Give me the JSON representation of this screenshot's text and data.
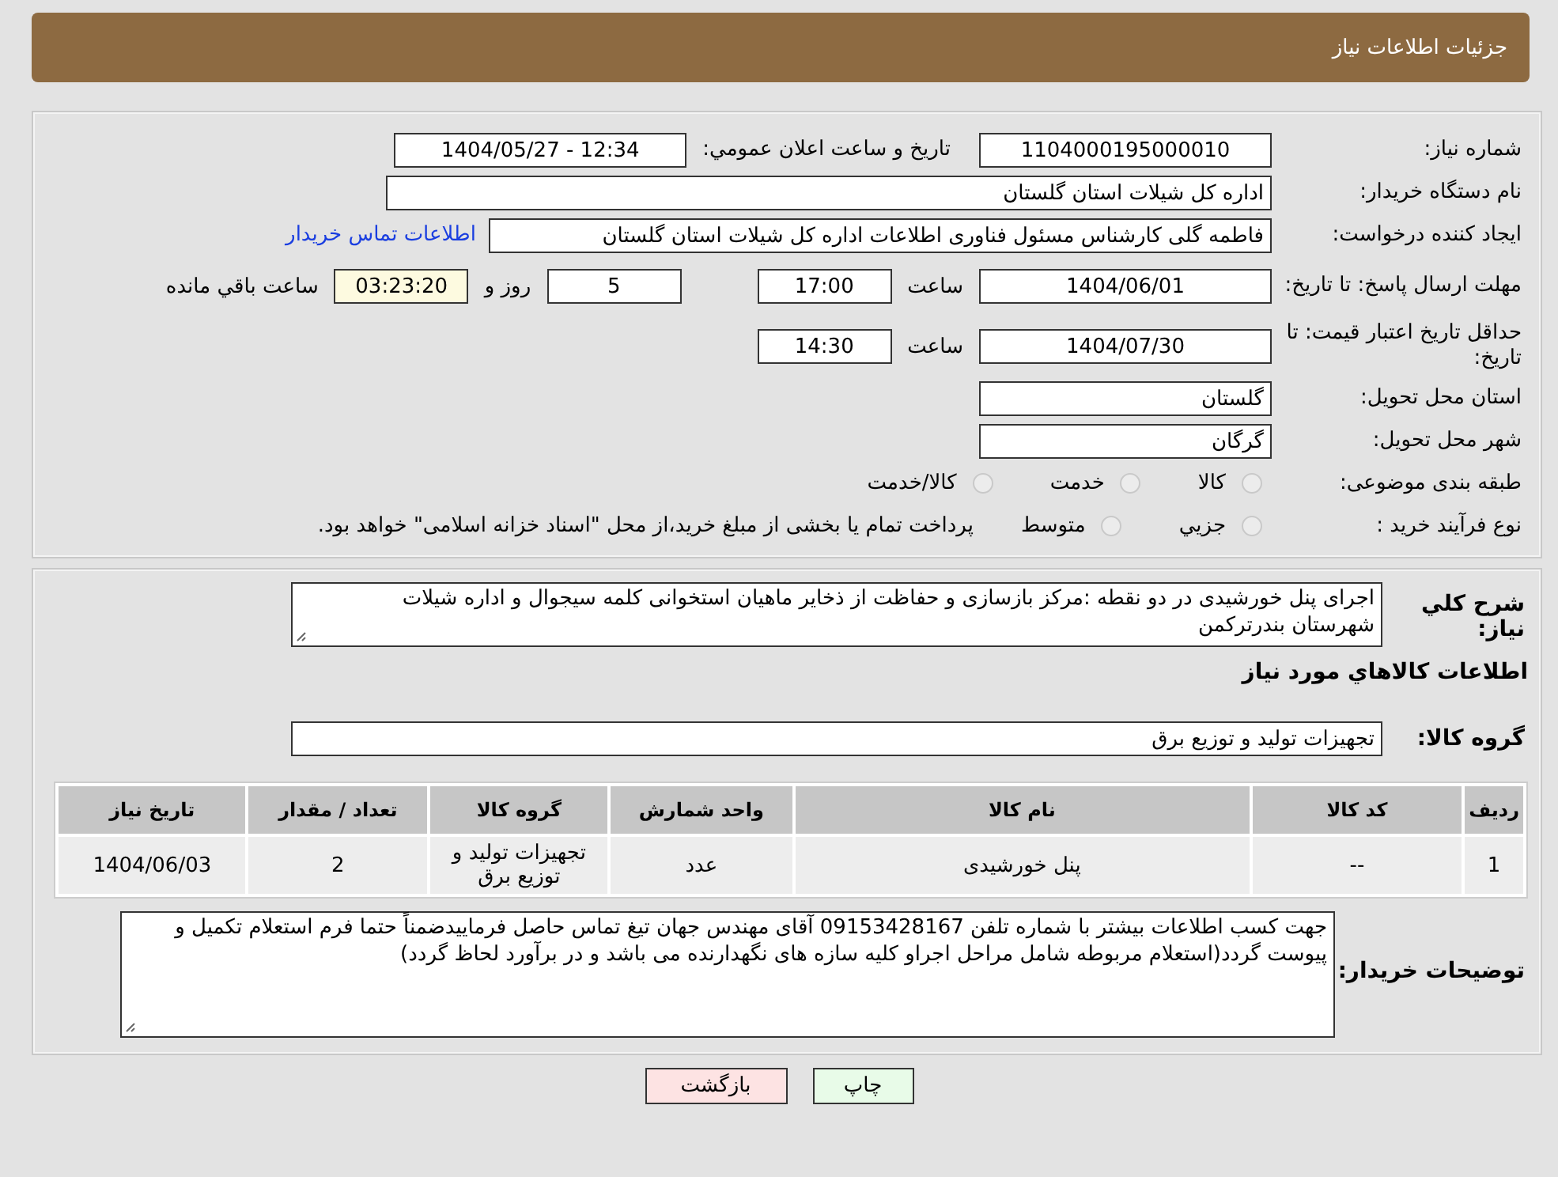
{
  "header": {
    "title": "جزئیات اطلاعات نیاز"
  },
  "need_number": {
    "label": "شماره نیاز:",
    "value": "1104000195000010"
  },
  "announce": {
    "label": "تاریخ و ساعت اعلان عمومي:",
    "value": "1404/05/27 - 12:34"
  },
  "buyer": {
    "label": "نام دستگاه خریدار:",
    "value": "اداره کل شیلات استان گلستان"
  },
  "creator": {
    "label": "ایجاد کننده درخواست:",
    "value": "فاطمه گلی کارشناس مسئول فناوری اطلاعات اداره کل شیلات استان گلستان",
    "link": "اطلاعات تماس خریدار"
  },
  "deadline": {
    "label": "مهلت ارسال پاسخ: تا تاریخ:",
    "date": "1404/06/01",
    "time_label": "ساعت",
    "time": "17:00",
    "days": "5",
    "days_label": "روز و",
    "remaining": "03:23:20",
    "remaining_label": "ساعت باقي مانده"
  },
  "validity": {
    "label": "حداقل تاریخ اعتبار قیمت: تا تاریخ:",
    "date": "1404/07/30",
    "time_label": "ساعت",
    "time": "14:30"
  },
  "province": {
    "label": "استان محل تحویل:",
    "value": "گلستان"
  },
  "city": {
    "label": "شهر محل تحویل:",
    "value": "گرگان"
  },
  "category": {
    "label": "طبقه بندی موضوعی:",
    "options": [
      {
        "label": "کالا",
        "selected": false
      },
      {
        "label": "خدمت",
        "selected": false
      },
      {
        "label": "کالا/خدمت",
        "selected": false
      }
    ]
  },
  "process": {
    "label": "نوع فرآیند خرید :",
    "options": [
      {
        "label": "جزيي",
        "selected": false
      },
      {
        "label": "متوسط",
        "selected": false
      }
    ],
    "note": "پرداخت تمام یا بخشی از مبلغ خرید،از محل \"اسناد خزانه اسلامی\" خواهد بود."
  },
  "description": {
    "label": "شرح کلي نياز:",
    "value": "اجرای پنل خورشیدی در دو نقطه :مرکز بازسازی و حفاظت از ذخایر ماهیان استخوانی کلمه سیجوال و اداره شیلات شهرستان بندرترکمن"
  },
  "goods_heading": "اطلاعات کالاهاي مورد نياز",
  "goods_group": {
    "label": "گروه کالا:",
    "value": "تجهیزات تولید و توزیع برق"
  },
  "table": {
    "columns": [
      "رديف",
      "کد کالا",
      "نام کالا",
      "واحد شمارش",
      "گروه کالا",
      "تعداد / مقدار",
      "تاريخ نياز"
    ],
    "rows": [
      [
        "1",
        "--",
        "پنل خورشیدی",
        "عدد",
        "تجهیزات تولید و توزیع برق",
        "2",
        "1404/06/03"
      ]
    ]
  },
  "buyer_notes": {
    "label": "توضیحات خریدار:",
    "value": "جهت کسب اطلاعات بیشتر با شماره تلفن 09153428167 آقای مهندس جهان تیغ تماس حاصل فرماییدضمناً حتما فرم استعلام تکمیل و پیوست گردد(استعلام مربوطه شامل مراحل اجراو کلیه سازه های نگهدارنده می باشد و در برآورد لحاظ گردد)"
  },
  "buttons": [
    {
      "label": "چاپ",
      "kind": "print"
    },
    {
      "label": "بازگشت",
      "kind": "back"
    }
  ]
}
